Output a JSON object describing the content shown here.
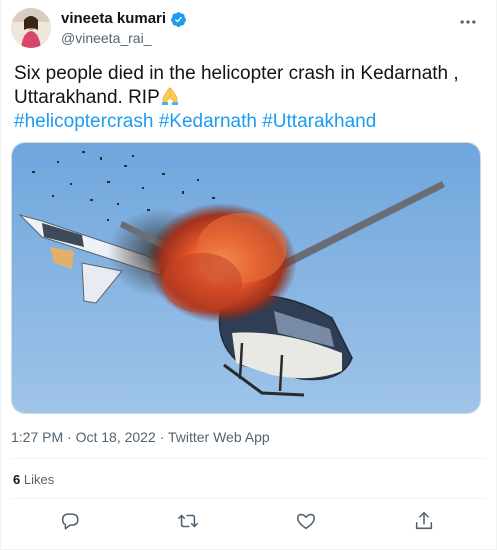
{
  "author": {
    "display_name": "vineeta kumari",
    "handle": "@vineeta_rai_"
  },
  "tweet": {
    "text_line1": "Six people died in the helicopter crash in Kedarnath ,",
    "text_line2": "Uttarakhand.  RIP",
    "hashtags": [
      "#helicoptercrash",
      "#Kedarnath",
      "#Uttarakhand"
    ]
  },
  "meta": {
    "time": "1:27 PM",
    "separator": "·",
    "date": "Oct 18, 2022",
    "source": "Twitter Web App"
  },
  "stats": {
    "likes_count": "6",
    "likes_label": "Likes"
  },
  "icons": {
    "verified": "verified-badge-icon",
    "more": "more-options-icon",
    "reply": "reply-icon",
    "retweet": "retweet-icon",
    "like": "like-heart-icon",
    "share": "share-icon",
    "emoji": "folded-hands-emoji"
  },
  "colors": {
    "accent": "#1d9bf0",
    "secondary_text": "#536471",
    "primary_text": "#0f1419"
  }
}
